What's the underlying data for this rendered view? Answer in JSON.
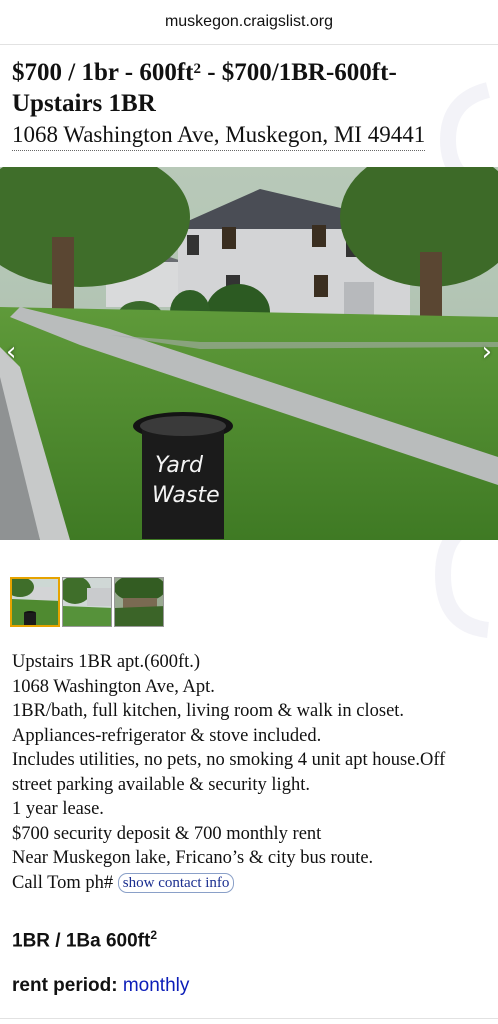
{
  "browser": {
    "url": "muskegon.craigslist.org"
  },
  "posting": {
    "title_main": "$700 / 1br - 600ft",
    "title_sup": "2",
    "title_rest": " - $700/1BR-600ft-Upstairs 1BR",
    "address": "1068 Washington Ave, Muskegon, MI 49441"
  },
  "gallery": {
    "prev_arrow": "‹",
    "next_arrow": "›",
    "can_text_line1": "Yard",
    "can_text_line2": "Waste"
  },
  "body": {
    "lines": [
      "Upstairs 1BR apt.(600ft.)",
      "1068 Washington Ave, Apt.",
      "1BR/bath, full kitchen, living room & walk in closet.",
      "Appliances-refrigerator & stove included.",
      "Includes utilities, no pets, no smoking 4 unit apt house.Off",
      "street parking available & security light.",
      "1 year lease.",
      "$700 security deposit & 700 monthly rent",
      "Near Muskegon lake, Fricano’s & city bus route."
    ],
    "call_prefix": "Call Tom ph# ",
    "show_contact": "show contact info"
  },
  "attributes": {
    "beds_baths": "1BR / 1Ba 600ft",
    "beds_baths_sup": "2",
    "rent_label": "rent period: ",
    "rent_value": "monthly"
  },
  "colors": {
    "link": "#0b1db8",
    "thumb_active": "#e6a300"
  }
}
